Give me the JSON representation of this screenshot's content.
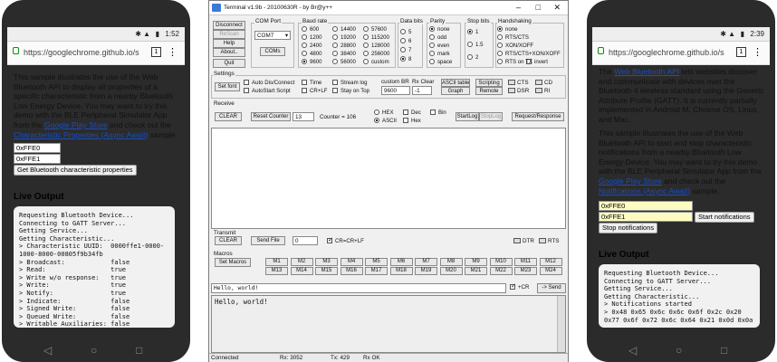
{
  "left_phone": {
    "status_time": "1:52",
    "url": "https://googlechrome.github.io/s",
    "tabs_count": "1",
    "intro_1": "This sample illustrates the use of the Web Bluetooth API to display all properties of a specific characteristic from a nearby Bluetooth Low Energy Device. You may want to try this demo with the BLE Peripheral Simulator App from the ",
    "link_store": "Google Play Store",
    "intro_2": " and check out the ",
    "link_related": "Characteristic Properties (Async Await)",
    "intro_3": " sample.",
    "service_value": "0xFFE0",
    "characteristic_value": "0xFFE1",
    "button": "Get Bluetooth characteristic properties",
    "heading": "Live Output",
    "log": "Requesting Bluetooth Device...\nConnecting to GATT Server...\nGetting Service...\nGetting Characteristic...\n> Characteristic UUID:  0000ffe1-0000-\n1000-8000-00805f9b34fb\n> Broadcast:            false\n> Read:                 true\n> Write w/o response:   true\n> Write:                true\n> Notify:               true\n> Indicate:             false\n> Signed Write:         false\n> Queued Write:         false\n> Writable Auxiliaries: false"
  },
  "terminal": {
    "title": "Terminal v1.9b - 20100630R - by Br@y++",
    "buttons": {
      "connect": "Disconnect",
      "rescan": "ReScan",
      "help": "Help",
      "about": "About..",
      "quit": "Quit",
      "comsel": "COMs"
    },
    "com_port_label": "COM Port",
    "com_port_value": "COM7",
    "baud_label": "Baud rate",
    "baud": [
      "600",
      "1200",
      "2400",
      "4800",
      "9600",
      "14400",
      "19200",
      "28800",
      "38400",
      "56000",
      "57600",
      "115200",
      "128000",
      "256000",
      "custom"
    ],
    "databits_label": "Data bits",
    "databits": [
      "5",
      "6",
      "7",
      "8"
    ],
    "parity_label": "Parity",
    "parity": [
      "none",
      "odd",
      "even",
      "mark",
      "space"
    ],
    "stopbits_label": "Stop bits",
    "stopbits": [
      "1",
      "1.5",
      "2"
    ],
    "handshake_label": "Handshaking",
    "handshake": [
      "none",
      "RTS/CTS",
      "XON/XOFF",
      "RTS/CTS+XON/XOFF",
      "RTS on TX"
    ],
    "invert": "invert",
    "settings_label": "Settings",
    "setfont": "Set font",
    "settings_checks": [
      "Auto Dis/Connect",
      "AutoStart Script",
      "Time",
      "CR+LF",
      "Stream log",
      "Stay on Top"
    ],
    "custom_br": "custom BR",
    "custom_br_value": "9600",
    "rx_clear": "Rx Clear",
    "rx_clear_value": "-1",
    "ascii_table": "ASCII table",
    "graph": "Graph",
    "scripting": "Scripting",
    "remote": "Remote",
    "leds_top": [
      "CTS",
      "DSR",
      "CD",
      "RI"
    ],
    "receive_label": "Receive",
    "clear": "CLEAR",
    "reset_counter": "Reset Counter",
    "counter_spin": "13",
    "counter": "Counter = 106",
    "recv_modes": [
      "HEX",
      "ASCII"
    ],
    "recv_checks": [
      "Dec",
      "Hex",
      "Bin"
    ],
    "startlog": "StartLog",
    "stoplog": "StopLog",
    "req_resp": "Request/Response",
    "transmit_label": "Transmit",
    "tx_clear": "CLEAR",
    "send_file": "Send File",
    "tx_spin": "0",
    "tx_crlf": "CR=CR+LF",
    "tx_leds": [
      "DTR",
      "RTS"
    ],
    "macros_label": "Macros",
    "set_macros": "Set Macros",
    "macros_row1": [
      "M1",
      "M2",
      "M3",
      "M4",
      "M5",
      "M6",
      "M7",
      "M8",
      "M9",
      "M10",
      "M11",
      "M12"
    ],
    "macros_row2": [
      "M13",
      "M14",
      "M15",
      "M16",
      "M17",
      "M18",
      "M19",
      "M20",
      "M21",
      "M22",
      "M23",
      "M24"
    ],
    "send_input": "Hello, world!",
    "send_cr": "+CR",
    "send_btn": "-> Send",
    "terminal_text": "Hello, world!",
    "status": [
      "Connected",
      "Rx: 3052",
      "Tx: 429",
      "Rx OK"
    ]
  },
  "right_phone": {
    "status_time": "2:39",
    "url": "https://googlechrome.github.io/s",
    "tabs_count": "1",
    "p1_a": "The ",
    "p1_link": "Web Bluetooth API",
    "p1_b": " lets websites discover and communicate with devices over the Bluetooth 4 wireless standard using the Generic Attribute Profile (GATT). It is currently partially implemented in Android M, Chrome OS, Linux, and Mac.",
    "p2_a": "This sample illustrates the use of the Web Bluetooth API to start and stop characteristic notifications from a nearby Bluetooth Low Energy Device. You may want to try this demo with the BLE Peripheral Simulator App from the ",
    "p2_link1": "Google Play Store",
    "p2_b": " and check out the ",
    "p2_link2": "Notifications (Async Await)",
    "p2_c": " sample.",
    "service_value": "0xFFE0",
    "characteristic_value": "0xFFE1",
    "start_btn": "Start notifications",
    "stop_btn": "Stop notifications",
    "heading": "Live Output",
    "log": "Requesting Bluetooth Device...\nConnecting to GATT Server...\nGetting Service...\nGetting Characteristic...\n> Notifications started\n> 0x48 0x65 0x6c 0x6c 0x6f 0x2c 0x20\n0x77 0x6f 0x72 0x6c 0x64 0x21 0x0d 0x0a"
  },
  "colors": {
    "link": "#1a4ec0",
    "input_yellow": "#fcfbc2",
    "term_bg": "#ffffff"
  }
}
